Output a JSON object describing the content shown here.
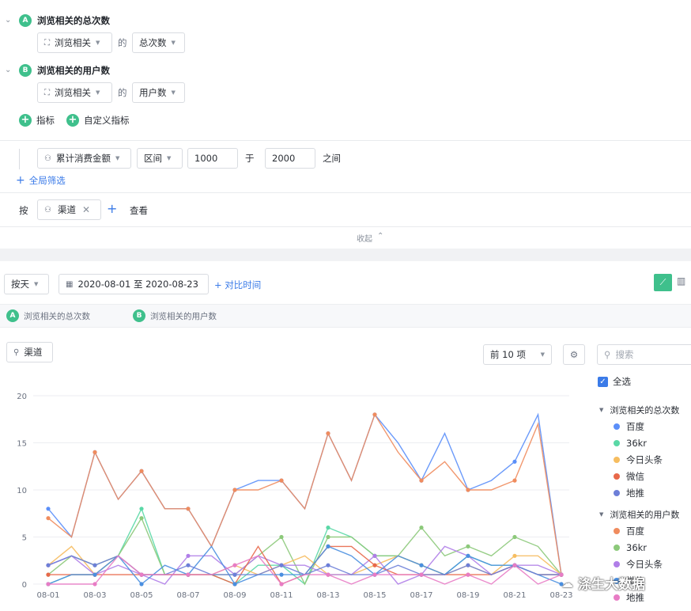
{
  "metrics": [
    {
      "letter": "A",
      "title": "浏览相关的总次数",
      "event": "浏览相关",
      "of": "的",
      "measure": "总次数"
    },
    {
      "letter": "B",
      "title": "浏览相关的用户数",
      "event": "浏览相关",
      "of": "的",
      "measure": "用户数"
    }
  ],
  "add_metric": "指标",
  "add_custom_metric": "自定义指标",
  "filter": {
    "property": "累计消费金额",
    "operator": "区间",
    "from": "1000",
    "between_word": "于",
    "to": "2000",
    "end_word": "之间"
  },
  "global_filter": "全局筛选",
  "group": {
    "by_label": "按",
    "dimension": "渠道",
    "view_label": "查看"
  },
  "collapse_label": "收起",
  "toolbar": {
    "granularity": "按天",
    "date_range": "2020-08-01 至 2020-08-23",
    "compare": "+ 对比时间"
  },
  "metric_legend": [
    {
      "letter": "A",
      "label": "浏览相关的总次数"
    },
    {
      "letter": "B",
      "label": "浏览相关的用户数"
    }
  ],
  "chart_controls": {
    "dimension": "渠道",
    "topn": "前 10 项",
    "search_placeholder": "搜索"
  },
  "legend": {
    "select_all": "全选",
    "groups": [
      {
        "title": "浏览相关的总次数",
        "items": [
          {
            "name": "百度",
            "color": "#5b8ff9"
          },
          {
            "name": "36kr",
            "color": "#5ad8a6"
          },
          {
            "name": "今日头条",
            "color": "#f6bd60"
          },
          {
            "name": "微信",
            "color": "#e8684a"
          },
          {
            "name": "地推",
            "color": "#6d7fd8"
          }
        ]
      },
      {
        "title": "浏览相关的用户数",
        "items": [
          {
            "name": "百度",
            "color": "#f08c5e"
          },
          {
            "name": "36kr",
            "color": "#8cc97a"
          },
          {
            "name": "今日头条",
            "color": "#b07ee8"
          },
          {
            "name": "微信",
            "color": "#4a8fe0"
          },
          {
            "name": "地推",
            "color": "#e87cc5"
          }
        ]
      }
    ]
  },
  "watermark": "涤生大数据",
  "chart_data": {
    "type": "line",
    "x": [
      "08-01",
      "08-02",
      "08-03",
      "08-04",
      "08-05",
      "08-06",
      "08-07",
      "08-08",
      "08-09",
      "08-10",
      "08-11",
      "08-12",
      "08-13",
      "08-14",
      "08-15",
      "08-16",
      "08-17",
      "08-18",
      "08-19",
      "08-20",
      "08-21",
      "08-22",
      "08-23"
    ],
    "x_tick_labels": [
      "08-01",
      "08-03",
      "08-05",
      "08-07",
      "08-09",
      "08-11",
      "08-13",
      "08-15",
      "08-17",
      "08-19",
      "08-21",
      "08-23"
    ],
    "ylim": [
      0,
      20
    ],
    "y_ticks": [
      0,
      5,
      10,
      15,
      20
    ],
    "grid": true,
    "series": [
      {
        "name": "百度",
        "group": "浏览相关的总次数",
        "color": "#5b8ff9",
        "values": [
          8,
          5,
          14,
          9,
          12,
          8,
          8,
          4,
          10,
          11,
          11,
          8,
          16,
          11,
          18,
          15,
          11,
          16,
          10,
          11,
          13,
          18,
          1
        ]
      },
      {
        "name": "百度",
        "group": "浏览相关的用户数",
        "color": "#f08c5e",
        "values": [
          7,
          5,
          14,
          9,
          12,
          8,
          8,
          4,
          10,
          10,
          11,
          8,
          16,
          11,
          18,
          14,
          11,
          13,
          10,
          10,
          11,
          17,
          1
        ]
      },
      {
        "name": "36kr",
        "group": "浏览相关的总次数",
        "color": "#5ad8a6",
        "values": [
          0,
          1,
          1,
          3,
          8,
          1,
          1,
          1,
          0,
          2,
          2,
          0,
          6,
          5,
          3,
          3,
          2,
          1,
          3,
          2,
          2,
          1,
          1
        ]
      },
      {
        "name": "36kr",
        "group": "浏览相关的用户数",
        "color": "#8cc97a",
        "values": [
          1,
          3,
          2,
          3,
          7,
          1,
          1,
          1,
          1,
          3,
          5,
          0,
          5,
          5,
          3,
          3,
          6,
          3,
          4,
          3,
          5,
          4,
          1
        ]
      },
      {
        "name": "今日头条",
        "group": "浏览相关的总次数",
        "color": "#f6bd60",
        "values": [
          2,
          4,
          1,
          3,
          1,
          1,
          1,
          1,
          2,
          1,
          2,
          3,
          1,
          1,
          2,
          3,
          2,
          1,
          2,
          1,
          3,
          3,
          1
        ]
      },
      {
        "name": "今日头条",
        "group": "浏览相关的用户数",
        "color": "#b07ee8",
        "values": [
          2,
          3,
          1,
          2,
          1,
          0,
          3,
          3,
          1,
          3,
          2,
          2,
          1,
          1,
          3,
          0,
          1,
          4,
          3,
          1,
          2,
          2,
          1
        ]
      },
      {
        "name": "微信",
        "group": "浏览相关的总次数",
        "color": "#e8684a",
        "values": [
          1,
          1,
          1,
          1,
          1,
          1,
          1,
          1,
          0,
          4,
          0,
          1,
          4,
          4,
          2,
          1,
          1,
          1,
          1,
          1,
          2,
          1,
          1
        ]
      },
      {
        "name": "微信",
        "group": "浏览相关的用户数",
        "color": "#4a8fe0",
        "values": [
          0,
          1,
          1,
          3,
          0,
          2,
          1,
          4,
          0,
          1,
          1,
          1,
          4,
          3,
          1,
          3,
          2,
          1,
          3,
          2,
          2,
          1,
          0
        ]
      },
      {
        "name": "地推",
        "group": "浏览相关的总次数",
        "color": "#6d7fd8",
        "values": [
          2,
          3,
          2,
          3,
          1,
          1,
          2,
          1,
          1,
          1,
          2,
          1,
          2,
          1,
          1,
          2,
          1,
          1,
          2,
          1,
          2,
          1,
          1
        ]
      },
      {
        "name": "地推",
        "group": "浏览相关的用户数",
        "color": "#e87cc5",
        "values": [
          0,
          0,
          0,
          3,
          1,
          1,
          1,
          1,
          2,
          3,
          0,
          1,
          1,
          0,
          1,
          1,
          1,
          0,
          1,
          0,
          2,
          0,
          1
        ]
      }
    ]
  }
}
